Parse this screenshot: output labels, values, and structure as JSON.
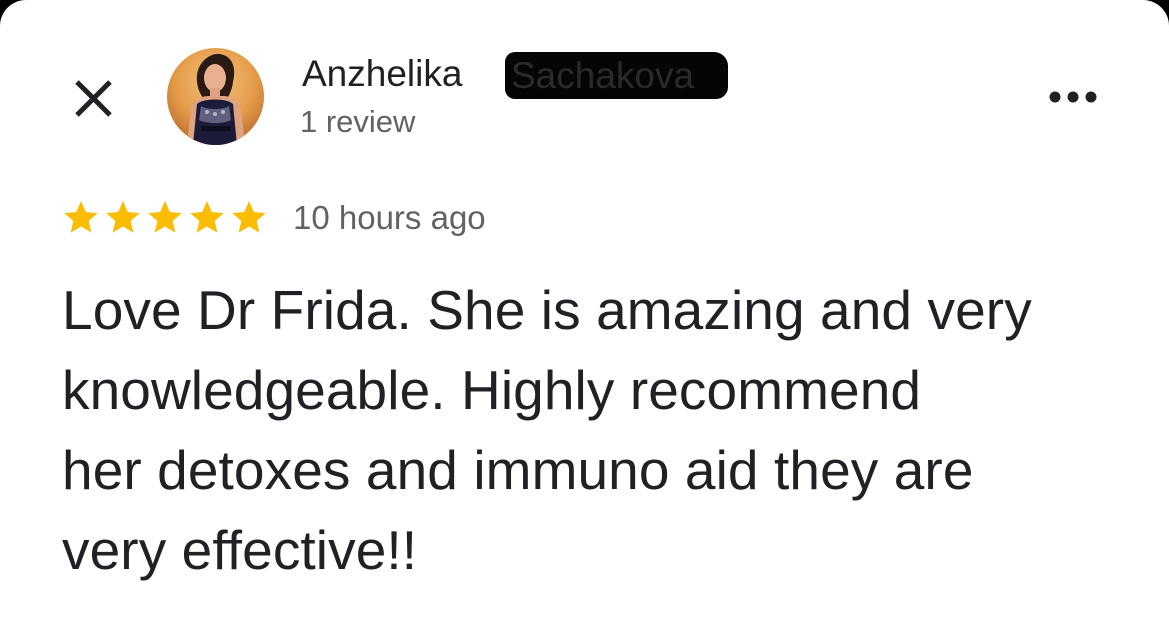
{
  "colors": {
    "background": "#ffffff",
    "primary_text": "#202124",
    "secondary_text": "#5f6368",
    "star": "#fbbc04",
    "redaction": "#050505"
  },
  "header": {
    "close_icon": "close-icon",
    "author_name": "Anzhelika",
    "author_surname_redacted": "Sachakova",
    "review_count": "1 review",
    "more_icon": "more-horizontal-icon"
  },
  "rating": {
    "stars": 5,
    "max": 5,
    "icon": "star-icon",
    "time_ago": "10 hours ago"
  },
  "review": {
    "lines": [
      "Love Dr Frida. She is amazing and very",
      "knowledgeable. Highly recommend",
      "her detoxes and immuno aid they are",
      "very effective!!"
    ]
  }
}
